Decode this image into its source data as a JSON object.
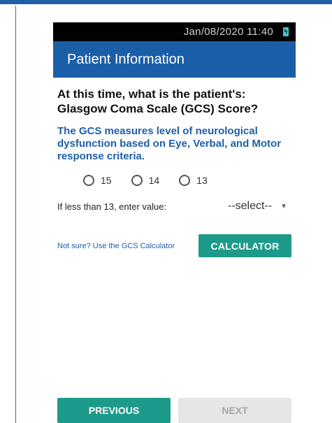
{
  "status_bar": {
    "time": "Jan/08/2020 11:40",
    "battery_icon": "battery-charging-icon"
  },
  "app_bar": {
    "title": "Patient Information"
  },
  "question": {
    "line1": "At this time, what is the patient's:",
    "line2": "Glasgow Coma Scale (GCS) Score?"
  },
  "info": "The GCS measures level of neurological dysfunction based on Eye, Verbal, and Motor response criteria.",
  "gcs_options": [
    "15",
    "14",
    "13"
  ],
  "lower_value": {
    "label": "If less than 13, enter value:",
    "selected": "--select--"
  },
  "calculator": {
    "link_text": "Not sure? Use the GCS Calculator",
    "button_label": "CALCULATOR"
  },
  "navigation": {
    "previous_label": "PREVIOUS",
    "next_label": "NEXT"
  },
  "colors": {
    "app_bar": "#1a5ea8",
    "accent_teal": "#1e9a8a",
    "info_text": "#1f5fa8",
    "disabled": "#e6e6e6"
  }
}
